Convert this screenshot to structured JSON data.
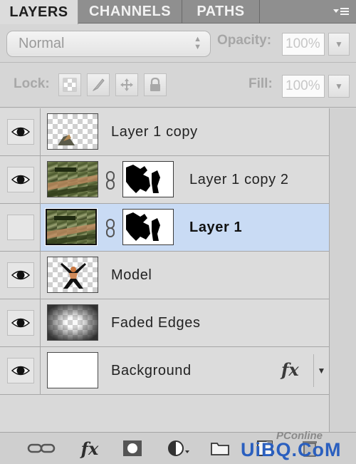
{
  "tabs": [
    {
      "label": "LAYERS",
      "active": true
    },
    {
      "label": "CHANNELS",
      "active": false
    },
    {
      "label": "PATHS",
      "active": false
    }
  ],
  "panel_menu_icon": "panel-menu-icon",
  "blend": {
    "mode": "Normal",
    "opacity_label": "Opacity:",
    "opacity_value": "100%"
  },
  "lock": {
    "label": "Lock:",
    "fill_label": "Fill:",
    "fill_value": "100%",
    "icons": [
      "lock-transparent-pixels-icon",
      "lock-image-pixels-icon",
      "lock-position-icon",
      "lock-all-icon"
    ]
  },
  "layers": [
    {
      "name": "Layer 1 copy",
      "visible": true,
      "selected": false,
      "has_mask": false
    },
    {
      "name": "Layer 1 copy 2",
      "visible": true,
      "selected": false,
      "has_mask": true
    },
    {
      "name": "Layer 1",
      "visible": false,
      "selected": true,
      "has_mask": true
    },
    {
      "name": "Model",
      "visible": true,
      "selected": false,
      "has_mask": false
    },
    {
      "name": "Faded Edges",
      "visible": true,
      "selected": false,
      "has_mask": false
    },
    {
      "name": "Background",
      "visible": true,
      "selected": false,
      "has_mask": false,
      "fx": "fx"
    }
  ],
  "toolbar": {
    "fx_label": "fx",
    "icons": [
      "link-layers-icon",
      "layer-style-icon",
      "add-mask-icon",
      "adjustment-layer-icon",
      "new-group-icon",
      "new-layer-icon",
      "delete-layer-icon"
    ]
  },
  "watermark": {
    "main": "UiBQ.CoM",
    "small": "PConline"
  },
  "colors": {
    "tab_bar": "#8f8f8f",
    "panel_bg": "#d6d6d6",
    "selected_row": "#c9dbf4",
    "watermark": "#2a5fbf"
  }
}
